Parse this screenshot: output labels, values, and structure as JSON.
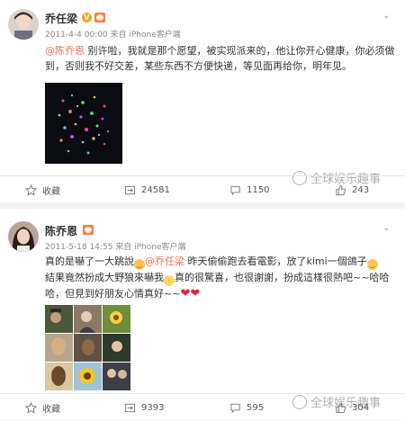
{
  "posts": [
    {
      "username": "乔任梁",
      "verified_badge": "V",
      "meta": "2011-4-4 00:00 来自 iPhone客户端",
      "text_lines": [
        {
          "mention": "@陈乔恩",
          "text": " 别许啦，我就是那个愿望，被实现派来的，他让你开心健康，你必须做"
        },
        {
          "mention": "",
          "text": "到，否则我不好交差，某些东西不方便快递，等见面再给你，明年见。"
        }
      ],
      "image": "starry-photo",
      "toolbar": {
        "favorite": "收藏",
        "repost": "24581",
        "comment": "1150",
        "like": "243"
      },
      "watermark": "全球娱乐趣事"
    },
    {
      "username": "陈乔恩",
      "meta": "2011-5-18 14:55 来自 iPhone客户端",
      "text_lines": [
        {
          "pre": "真的是嚇了一大跳說",
          "emoji": "laugh",
          "mention": "@乔任梁",
          "text": " 昨天偷偷跑去看電影，放了kimi一個鴿子",
          "emoji_end": "laugh"
        },
        {
          "text": "結果竟然扮成大野狼來嚇我",
          "emoji": "cry",
          "rest": "真的很驚喜，也很謝謝，扮成這樣很熱吧~~哈哈"
        },
        {
          "text": "哈，但見到好朋友心情真好~~",
          "hearts": "❤❤"
        }
      ],
      "images": "collage",
      "toolbar": {
        "favorite": "收藏",
        "repost": "9393",
        "comment": "595",
        "like": "304"
      },
      "watermark": "全球娱乐趣事"
    }
  ]
}
